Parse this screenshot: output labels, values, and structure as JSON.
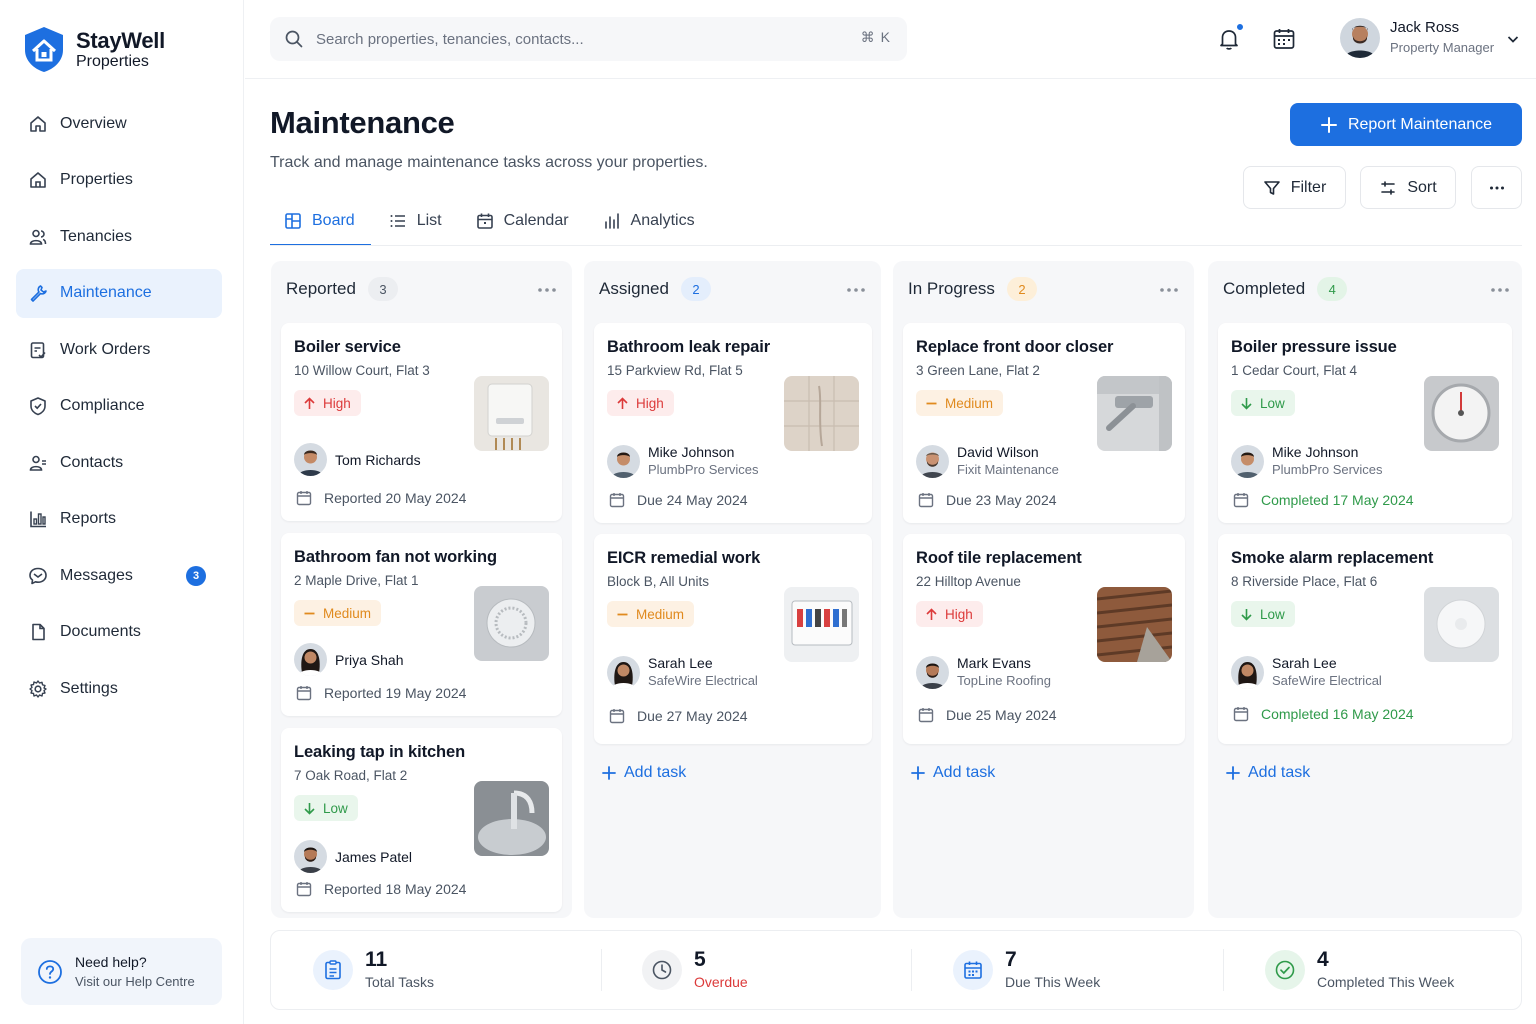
{
  "brand": {
    "name": "StayWell",
    "sub": "Properties"
  },
  "nav": [
    {
      "label": "Overview"
    },
    {
      "label": "Properties"
    },
    {
      "label": "Tenancies"
    },
    {
      "label": "Maintenance"
    },
    {
      "label": "Work Orders"
    },
    {
      "label": "Compliance"
    },
    {
      "label": "Contacts"
    },
    {
      "label": "Reports"
    },
    {
      "label": "Messages",
      "badge": "3"
    },
    {
      "label": "Documents"
    },
    {
      "label": "Settings"
    }
  ],
  "help": {
    "title": "Need help?",
    "link": "Visit our Help Centre"
  },
  "search": {
    "placeholder": "Search properties, tenancies, contacts...",
    "shortcut": "⌘ K"
  },
  "user": {
    "name": "Jack Ross",
    "role": "Property Manager"
  },
  "page": {
    "title": "Maintenance",
    "subtitle": "Track and manage maintenance tasks across your properties."
  },
  "actions": {
    "report": "Report Maintenance",
    "filter": "Filter",
    "sort": "Sort"
  },
  "tabs": [
    "Board",
    "List",
    "Calendar",
    "Analytics"
  ],
  "columns": [
    {
      "title": "Reported",
      "count": "3",
      "cards": [
        {
          "title": "Boiler service",
          "address": "10 Willow Court, Flat 3",
          "priority": "High",
          "person": "Tom Richards",
          "company": "",
          "date": "Reported 20 May 2024"
        },
        {
          "title": "Bathroom fan not working",
          "address": "2 Maple Drive, Flat 1",
          "priority": "Medium",
          "person": "Priya Shah",
          "company": "",
          "date": "Reported 19 May 2024"
        },
        {
          "title": "Leaking tap in kitchen",
          "address": "7 Oak Road, Flat 2",
          "priority": "Low",
          "person": "James Patel",
          "company": "",
          "date": "Reported 18 May 2024"
        }
      ]
    },
    {
      "title": "Assigned",
      "count": "2",
      "cards": [
        {
          "title": "Bathroom leak repair",
          "address": "15 Parkview Rd, Flat 5",
          "priority": "High",
          "person": "Mike Johnson",
          "company": "PlumbPro Services",
          "date": "Due 24 May 2024"
        },
        {
          "title": "EICR remedial work",
          "address": "Block B, All Units",
          "priority": "Medium",
          "person": "Sarah Lee",
          "company": "SafeWire Electrical",
          "date": "Due 27 May 2024"
        }
      ],
      "add": "Add task"
    },
    {
      "title": "In Progress",
      "count": "2",
      "cards": [
        {
          "title": "Replace front door closer",
          "address": "3 Green Lane, Flat 2",
          "priority": "Medium",
          "person": "David Wilson",
          "company": "Fixit Maintenance",
          "date": "Due 23 May 2024"
        },
        {
          "title": "Roof tile replacement",
          "address": "22 Hilltop Avenue",
          "priority": "High",
          "person": "Mark Evans",
          "company": "TopLine Roofing",
          "date": "Due 25 May 2024"
        }
      ],
      "add": "Add task"
    },
    {
      "title": "Completed",
      "count": "4",
      "cards": [
        {
          "title": "Boiler pressure issue",
          "address": "1 Cedar Court, Flat 4",
          "priority": "Low",
          "person": "Mike Johnson",
          "company": "PlumbPro Services",
          "date": "Completed 17 May 2024"
        },
        {
          "title": "Smoke alarm replacement",
          "address": "8 Riverside Place, Flat 6",
          "priority": "Low",
          "person": "Sarah Lee",
          "company": "SafeWire Electrical",
          "date": "Completed 16 May 2024"
        }
      ],
      "add": "Add task"
    }
  ],
  "stats": [
    {
      "value": "11",
      "label": "Total Tasks"
    },
    {
      "value": "5",
      "label": "Overdue"
    },
    {
      "value": "7",
      "label": "Due This Week"
    },
    {
      "value": "4",
      "label": "Completed This Week"
    }
  ],
  "colors": {
    "accent": "#1d6fe0",
    "high": "#dc3a3a",
    "medium": "#e08a1e",
    "low": "#2f9a4a"
  }
}
